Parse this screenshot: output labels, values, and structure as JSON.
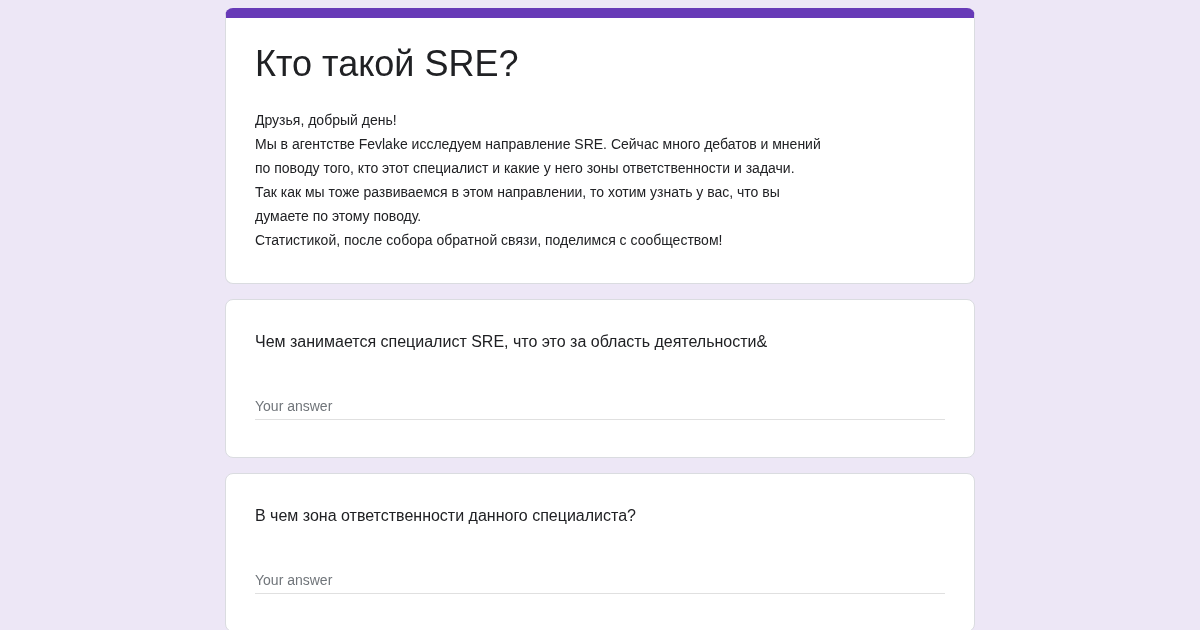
{
  "form": {
    "title": "Кто такой SRE?",
    "description": [
      "Друзья, добрый день!",
      "Мы в агентстве Fevlake исследуем направление SRE. Сейчас много дебатов и мнений",
      "по поводу того, кто этот специалист и какие у него зоны ответственности и задачи.",
      "Так как мы тоже развиваемся в этом направлении, то хотим узнать у вас, что вы",
      "думаете по этому поводу.",
      "Статистикой, после собора обратной связи, поделимся с сообществом!"
    ]
  },
  "questions": [
    {
      "title": "Чем занимается специалист SRE, что это за область деятельности&",
      "placeholder": "Your answer"
    },
    {
      "title": "В чем зона ответственности данного специалиста?",
      "placeholder": "Your answer"
    }
  ]
}
